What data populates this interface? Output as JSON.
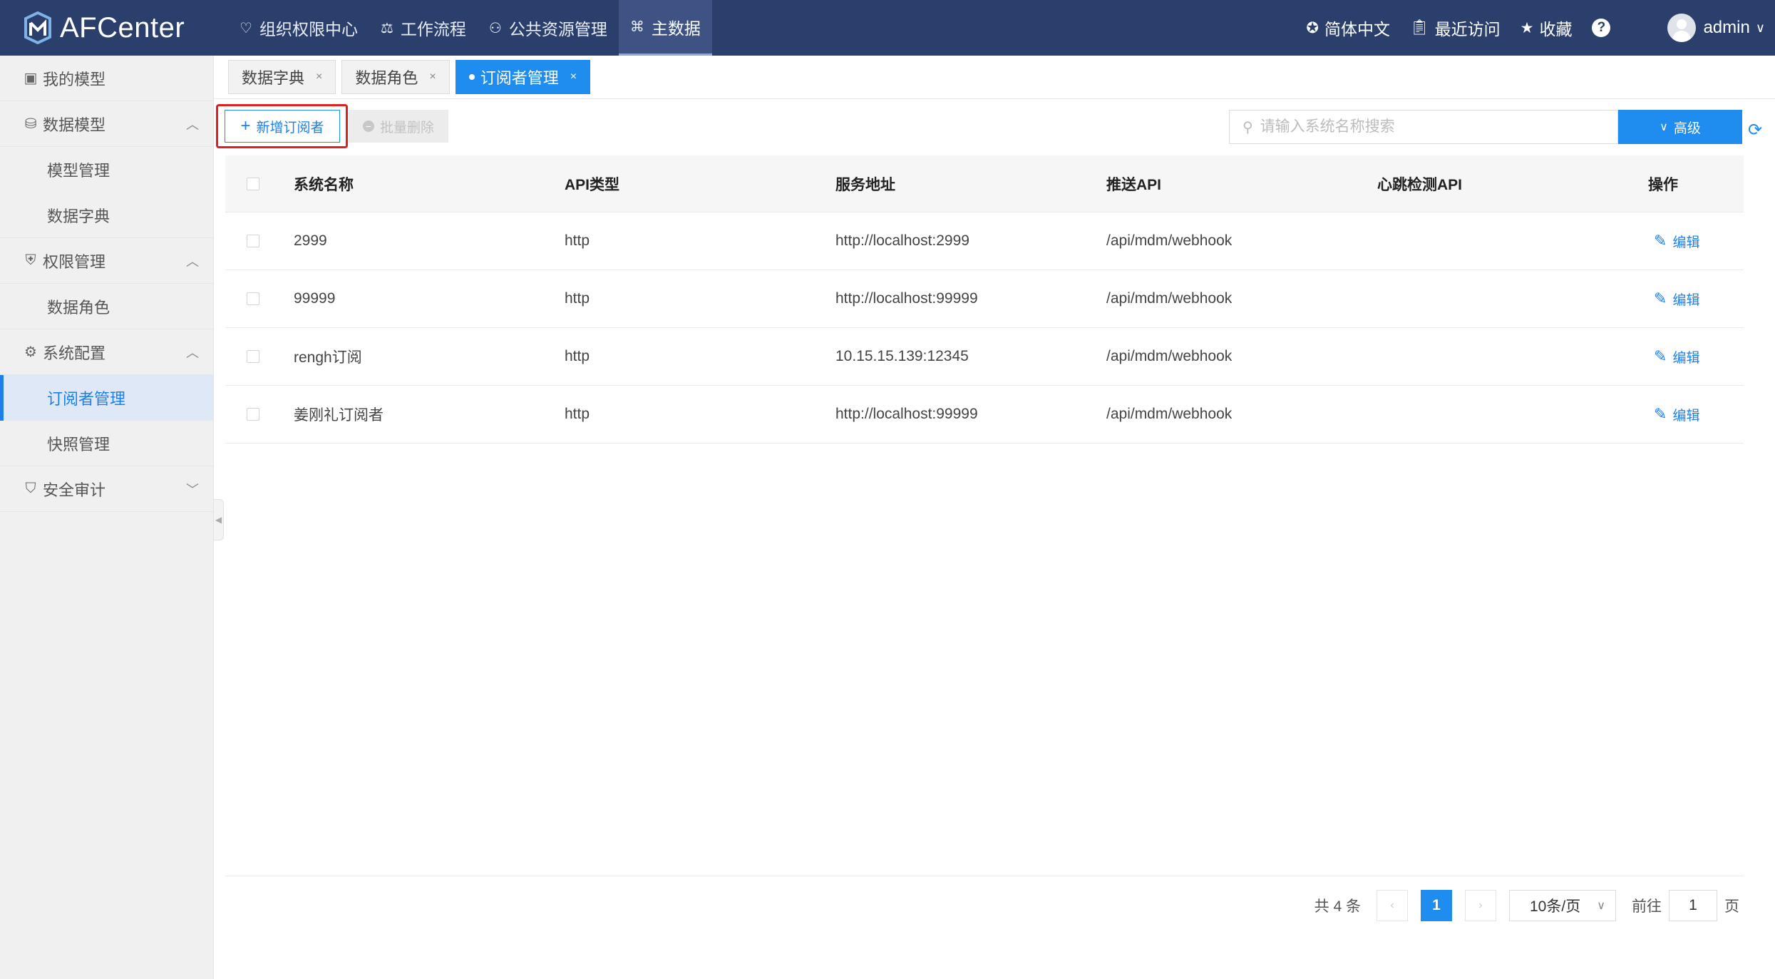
{
  "app": {
    "name": "AFCenter"
  },
  "topnav": [
    {
      "label": "组织权限中心",
      "icon": "shield-heart-icon",
      "active": false
    },
    {
      "label": "工作流程",
      "icon": "workflow-icon",
      "active": false
    },
    {
      "label": "公共资源管理",
      "icon": "people-icon",
      "active": false
    },
    {
      "label": "主数据",
      "icon": "data-icon",
      "active": true
    }
  ],
  "header_right": {
    "language": "简体中文",
    "recent": "最近访问",
    "favorites": "收藏",
    "help": "?",
    "user": "admin"
  },
  "sidebar": {
    "my_models": "我的模型",
    "data_model": "数据模型",
    "model_manage": "模型管理",
    "data_dict": "数据字典",
    "permission_manage": "权限管理",
    "data_role": "数据角色",
    "system_config": "系统配置",
    "subscriber_manage": "订阅者管理",
    "snapshot_manage": "快照管理",
    "security_audit": "安全审计"
  },
  "tabs": [
    {
      "label": "数据字典",
      "active": false
    },
    {
      "label": "数据角色",
      "active": false
    },
    {
      "label": "订阅者管理",
      "active": true
    }
  ],
  "tab_close": "×",
  "toolbar": {
    "add_label": "新增订阅者",
    "batch_delete_label": "批量删除",
    "search_placeholder": "请输入系统名称搜索",
    "advanced_label": "高级"
  },
  "table": {
    "columns": [
      "系统名称",
      "API类型",
      "服务地址",
      "推送API",
      "心跳检测API",
      "操作"
    ],
    "edit_label": "编辑",
    "rows": [
      {
        "name": "2999",
        "type": "http",
        "url": "http://localhost:2999",
        "push": "/api/mdm/webhook",
        "heartbeat": ""
      },
      {
        "name": "99999",
        "type": "http",
        "url": "http://localhost:99999",
        "push": "/api/mdm/webhook",
        "heartbeat": ""
      },
      {
        "name": "rengh订阅",
        "type": "http",
        "url": "10.15.15.139:12345",
        "push": "/api/mdm/webhook",
        "heartbeat": ""
      },
      {
        "name": "姜刚礼订阅者",
        "type": "http",
        "url": "http://localhost:99999",
        "push": "/api/mdm/webhook",
        "heartbeat": ""
      }
    ]
  },
  "pagination": {
    "total_text": "共 4 条",
    "current_page": "1",
    "page_size": "10条/页",
    "goto_label": "前往",
    "goto_value": "1",
    "page_suffix": "页"
  },
  "colors": {
    "header_bg": "#2b3f6c",
    "primary": "#1f8cf0",
    "highlight": "#e02020"
  }
}
